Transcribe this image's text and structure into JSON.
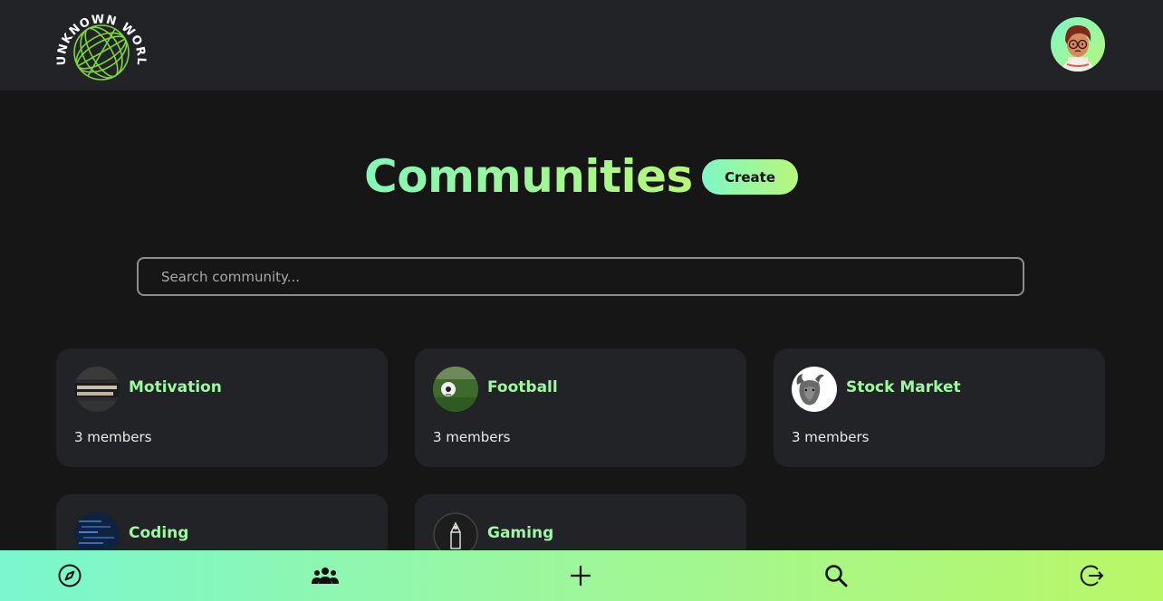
{
  "brand": {
    "logo_text": "UNKNOWN WORLD",
    "logo_color": "#7dd63a"
  },
  "header": {
    "avatar_icon": "profile-avatar"
  },
  "page": {
    "title": "Communities",
    "create_label": "Create",
    "accent_start": "#84f7b8",
    "accent_end": "#b7f77a"
  },
  "search": {
    "placeholder": "Search community...",
    "value": ""
  },
  "communities": [
    {
      "name": "Motivation",
      "members": "3 members"
    },
    {
      "name": "Football",
      "members": "3 members"
    },
    {
      "name": "Stock Market",
      "members": "3 members"
    },
    {
      "name": "Coding",
      "members": ""
    },
    {
      "name": "Gaming",
      "members": ""
    }
  ],
  "bottom_nav": [
    {
      "icon": "compass-icon",
      "label": "Explore"
    },
    {
      "icon": "group-icon",
      "label": "Communities"
    },
    {
      "icon": "plus-icon",
      "label": "Create post"
    },
    {
      "icon": "search-icon",
      "label": "Search"
    },
    {
      "icon": "logout-icon",
      "label": "Logout"
    }
  ]
}
